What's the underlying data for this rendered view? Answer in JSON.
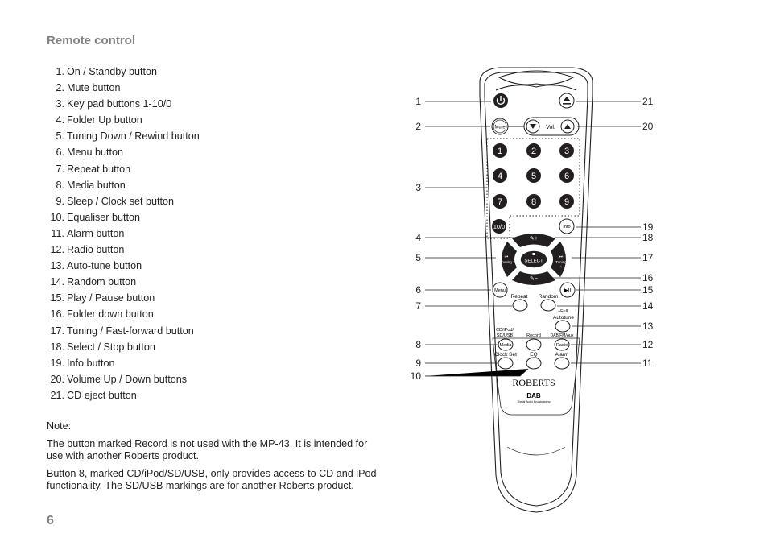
{
  "heading": "Remote control",
  "items": [
    {
      "num": "1.",
      "label": "On / Standby button"
    },
    {
      "num": "2.",
      "label": "Mute button"
    },
    {
      "num": "3.",
      "label": "Key pad buttons 1-10/0"
    },
    {
      "num": "4.",
      "label": "Folder Up button"
    },
    {
      "num": "5.",
      "label": "Tuning Down / Rewind button"
    },
    {
      "num": "6.",
      "label": "Menu button"
    },
    {
      "num": "7.",
      "label": "Repeat button"
    },
    {
      "num": "8.",
      "label": "Media button"
    },
    {
      "num": "9.",
      "label": "Sleep / Clock set button"
    },
    {
      "num": "10.",
      "label": "Equaliser button"
    },
    {
      "num": "11.",
      "label": "Alarm button"
    },
    {
      "num": "12.",
      "label": "Radio button"
    },
    {
      "num": "13.",
      "label": "Auto-tune button"
    },
    {
      "num": "14.",
      "label": "Random button"
    },
    {
      "num": "15.",
      "label": "Play / Pause button"
    },
    {
      "num": "16.",
      "label": "Folder down button"
    },
    {
      "num": "17.",
      "label": "Tuning / Fast-forward button"
    },
    {
      "num": "18.",
      "label": "Select / Stop button"
    },
    {
      "num": "19.",
      "label": "Info button"
    },
    {
      "num": "20.",
      "label": "Volume Up / Down buttons"
    },
    {
      "num": "21.",
      "label": "CD eject button"
    }
  ],
  "note": {
    "title": "Note:",
    "paragraphs": [
      "The button marked Record is not used with the MP-43. It is intended for use with another Roberts product.",
      "Button 8, marked CD/iPod/SD/USB, only provides access to CD and iPod functionality. The SD/USB markings are for another Roberts product."
    ]
  },
  "page_number": "6",
  "remote": {
    "mute": "Mute",
    "vol": "Vol.",
    "keys": [
      "1",
      "2",
      "3",
      "4",
      "5",
      "6",
      "7",
      "8",
      "9"
    ],
    "key_10": "10/0",
    "info": "Info",
    "select": "SELECT",
    "tuning": "Tuning",
    "menu": "Menu",
    "repeat": "Repeat",
    "random": "Random",
    "full_autotune_1": "+Full",
    "full_autotune_2": "Autotune",
    "media_top_1": "CD/iPod/",
    "media_top_2": "SD/USB",
    "media": "Media",
    "record": "Record",
    "radio_top": "DAB/FM/Aux",
    "radio": "Radio",
    "clock_set": "Clock Set",
    "eq": "EQ",
    "alarm": "Alarm",
    "brand": "ROBERTS",
    "dab_logo": "DAB",
    "dab_caption": "Digital Audio Broadcasting"
  },
  "callouts_left": [
    "1",
    "2",
    "3",
    "4",
    "5",
    "6",
    "7",
    "8",
    "9",
    "10"
  ],
  "callouts_right": [
    "21",
    "20",
    "19",
    "18",
    "17",
    "16",
    "15",
    "14",
    "13",
    "12",
    "11"
  ]
}
